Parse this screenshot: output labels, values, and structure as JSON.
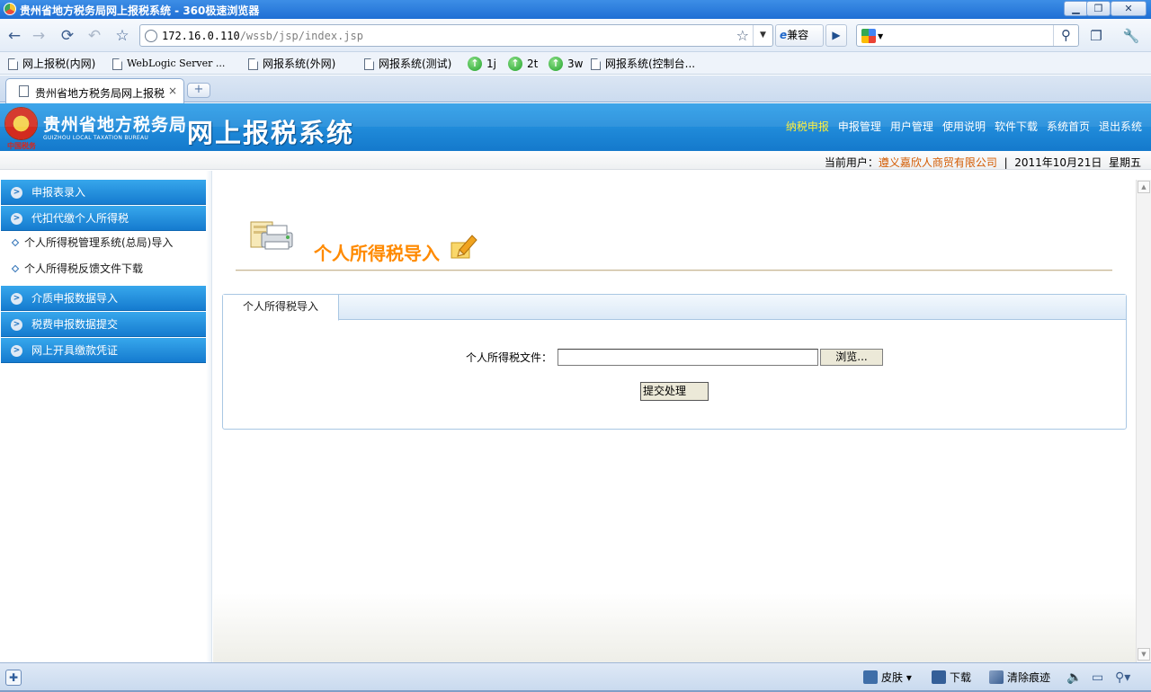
{
  "browser": {
    "window_title": "贵州省地方税务局网上报税系统 - 360极速浏览器",
    "window_controls": {
      "minimize": "▁",
      "restore": "❐",
      "close": "✕"
    },
    "url_host": "172.16.0.110",
    "url_path": "/wssb/jsp/index.jsp",
    "compat_label": "兼容",
    "compat_icon": "e",
    "bookmarks": [
      {
        "label": "网上报税(内网)",
        "icon": "page-icon"
      },
      {
        "label": "WebLogic Server ...",
        "icon": "page-icon"
      },
      {
        "label": "网报系统(外网)",
        "icon": "page-icon"
      },
      {
        "label": "网报系统(测试)",
        "icon": "page-icon"
      },
      {
        "label": "1j",
        "icon": "green-circle-icon"
      },
      {
        "label": "2t",
        "icon": "green-circle-icon"
      },
      {
        "label": "3w",
        "icon": "green-circle-icon"
      },
      {
        "label": "网报系统(控制台...",
        "icon": "page-icon"
      }
    ],
    "tab_title": "贵州省地方税务局网上报税",
    "tab_close": "×",
    "new_tab": "+",
    "status_items": {
      "skin": "皮肤",
      "download": "下载",
      "clear": "清除痕迹"
    }
  },
  "site": {
    "org_name_cn": "贵州省地方税务局",
    "org_name_en": "GUIZHOU LOCAL TAXATION BUREAU",
    "emblem_caption": "中国税务",
    "system_name": "网上报税系统",
    "topnav": [
      "纳税申报",
      "申报管理",
      "用户管理",
      "使用说明",
      "软件下载",
      "系统首页",
      "退出系统"
    ],
    "topnav_active": "纳税申报",
    "active_color": "#ffee33",
    "user_label": "当前用户：",
    "user_company": "遵义嘉欣人商贸有限公司",
    "separator": "|",
    "date": "2011年10月21日",
    "weekday": "星期五"
  },
  "sidebar": {
    "groups": [
      {
        "label": "申报表录入"
      },
      {
        "label": "代扣代缴个人所得税"
      }
    ],
    "sub_items": [
      {
        "label": "个人所得税管理系统(总局)导入"
      },
      {
        "label": "个人所得税反馈文件下载"
      }
    ],
    "more_groups": [
      {
        "label": "介质申报数据导入"
      },
      {
        "label": "税费申报数据提交"
      },
      {
        "label": "网上开具缴款凭证"
      }
    ]
  },
  "main": {
    "page_title": "个人所得税导入",
    "tab_label": "个人所得税导入",
    "file_label": "个人所得税文件：",
    "file_value": "",
    "browse_label": "浏览...",
    "submit_label": "提交处理"
  },
  "colors": {
    "header_blue": "#1479cc",
    "title_orange": "#ff8a00",
    "company_orange": "#d35a00"
  }
}
